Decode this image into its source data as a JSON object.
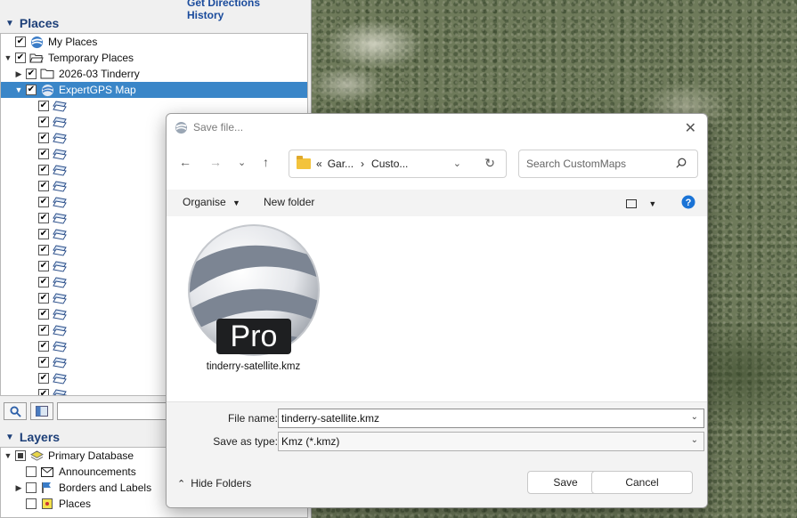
{
  "top_links": [
    "Get Directions",
    "History"
  ],
  "places": {
    "header": "Places",
    "items": [
      {
        "label": "My Places",
        "icon": "earth-icon"
      },
      {
        "label": "Temporary Places",
        "icon": "folder-open-icon"
      },
      {
        "label": "2026-03 Tinderry",
        "icon": "folder-icon"
      },
      {
        "label": "ExpertGPS Map",
        "icon": "earth-icon",
        "selected": true
      }
    ],
    "overlay_count": 19
  },
  "layers": {
    "header": "Layers",
    "items": [
      {
        "label": "Primary Database",
        "icon": "layers-icon"
      },
      {
        "label": "Announcements",
        "icon": "mail-icon"
      },
      {
        "label": "Borders and Labels",
        "icon": "flag-icon"
      },
      {
        "label": "Places",
        "icon": "place-icon"
      }
    ]
  },
  "dialog": {
    "title": "Save file...",
    "breadcrumb": {
      "chevron": "«",
      "part1": "Gar...",
      "sep": "›",
      "part2": "Custo..."
    },
    "search_placeholder": "Search CustomMaps",
    "organise": "Organise",
    "new_folder": "New folder",
    "file": {
      "badge": "Pro",
      "name": "tinderry-satellite.kmz"
    },
    "file_name_label": "File name:",
    "file_name_value": "tinderry-satellite.kmz",
    "save_type_label": "Save as type:",
    "save_type_value": "Kmz (*.kmz)",
    "hide_folders": "Hide Folders",
    "save_button": "Save",
    "cancel_button": "Cancel"
  },
  "colors": {
    "selection": "#3a86c8",
    "header_text": "#1d3f78",
    "help_blue": "#1a73d6"
  }
}
